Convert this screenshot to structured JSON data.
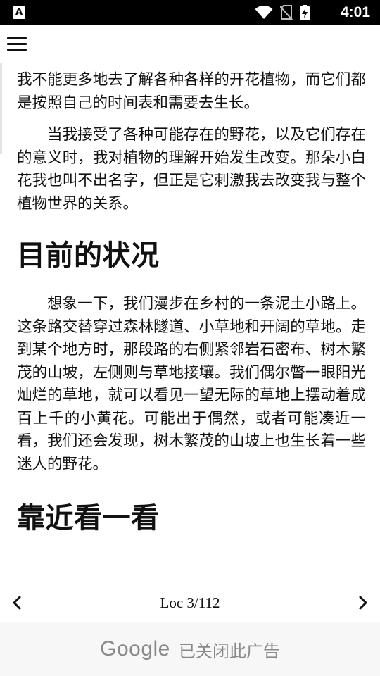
{
  "status_bar": {
    "app_icon_letter": "A",
    "time": "4:01",
    "icons": [
      "wifi-icon",
      "no-sim-icon",
      "battery-charging-icon"
    ]
  },
  "toolbar": {
    "menu_icon": "hamburger-menu-icon"
  },
  "book": {
    "paragraphs": [
      "我不能更多地去了解各种各样的开花植物，而它们都是按照自己的时间表和需要去生长。",
      "当我接受了各种可能存在的野花，以及它们存在的意义时，我对植物的理解开始发生改变。那朵小白花我也叫不出名字，但正是它刺激我去改变我与整个植物世界的关系。"
    ],
    "heading_1": "目前的状况",
    "paragraph_3": "想象一下，我们漫步在乡村的一条泥土小路上。这条路交替穿过森林隧道、小草地和开阔的草地。走到某个地方时，那段路的右侧紧邻岩石密布、树木繁茂的山坡，左侧则与草地接壤。我们偶尔瞥一眼阳光灿烂的草地，就可以看见一望无际的草地上摆动着成百上千的小黄花。可能出于偶然，或者可能凑近一看，我们还会发现，树木繁茂的山坡上也生长着一些迷人的野花。",
    "heading_2": "靠近看一看"
  },
  "navigation": {
    "location": "Loc 3/112",
    "prev_icon": "chevron-left-icon",
    "next_icon": "chevron-right-icon"
  },
  "ad": {
    "brand": "Google",
    "message": "已关闭此广告"
  }
}
